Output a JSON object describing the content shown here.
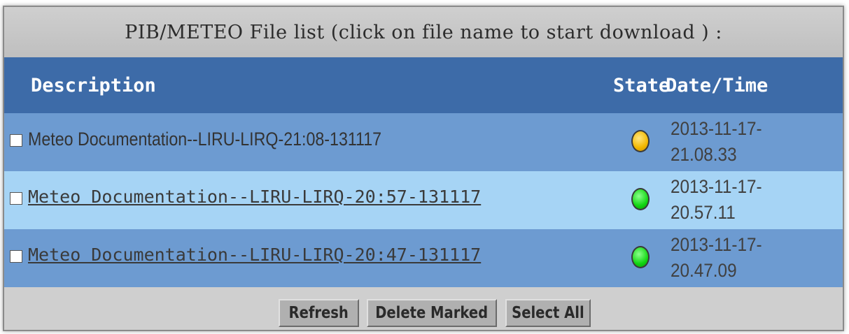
{
  "title": "PIB/METEO File list (click on file name to start download ) :",
  "columns": {
    "description": "Description",
    "state": "State",
    "datetime": "Date/Time"
  },
  "files": [
    {
      "checked": false,
      "name": "Meteo Documentation--LIRU-LIRQ-21:08-131117",
      "is_link": false,
      "state": "yellow",
      "date": "2013-11-17-",
      "time": "21.08.33"
    },
    {
      "checked": false,
      "name": "Meteo Documentation--LIRU-LIRQ-20:57-131117",
      "is_link": true,
      "state": "green",
      "date": "2013-11-17-",
      "time": "20.57.11"
    },
    {
      "checked": false,
      "name": "Meteo Documentation--LIRU-LIRQ-20:47-131117",
      "is_link": true,
      "state": "green",
      "date": "2013-11-17-",
      "time": "20.47.09"
    }
  ],
  "buttons": {
    "refresh": "Refresh",
    "delete_marked": "Delete Marked",
    "select_all": "Select All"
  },
  "colors": {
    "header_bg": "#3d6ba8",
    "row_dark": "#6d9bd1",
    "row_light": "#a6d4f5",
    "state_yellow": "#f2b800",
    "state_green": "#11d611"
  }
}
